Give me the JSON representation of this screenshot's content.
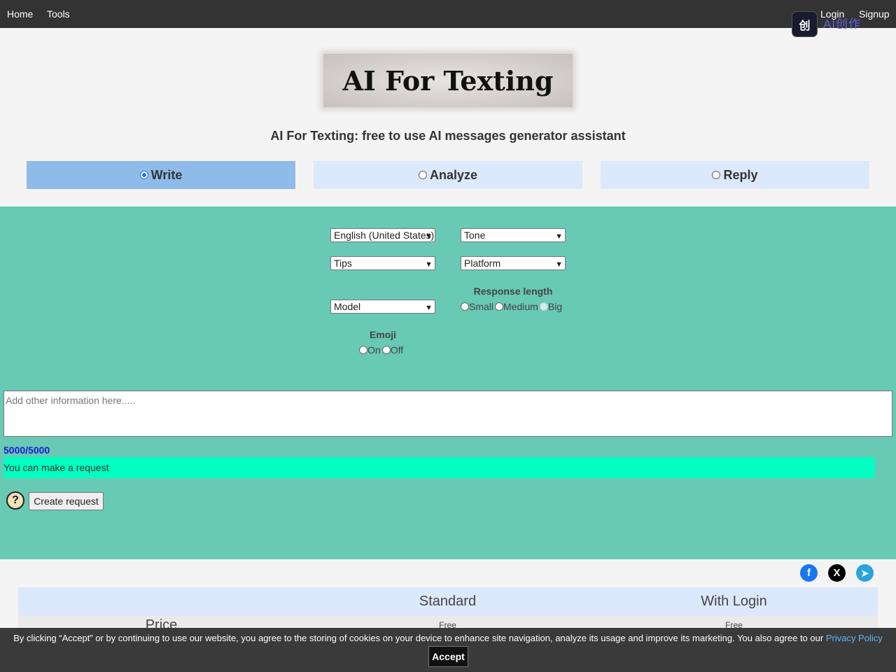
{
  "nav": {
    "home": "Home",
    "tools": "Tools",
    "login": "Login",
    "signup": "Signup",
    "brand_badge": "创",
    "brand_text": "AI创作"
  },
  "logo_text": "AI For Texting",
  "subtitle": "AI For Texting: free to use AI messages generator assistant",
  "modes": {
    "write": "Write",
    "analyze": "Analyze",
    "reply": "Reply",
    "selected": "Write"
  },
  "form": {
    "language": "English (United States)",
    "tone": "Tone",
    "tips": "Tips",
    "platform": "Platform",
    "model": "Model",
    "response_length_label": "Response length",
    "response_options": [
      "Small",
      "Medium",
      "Big"
    ],
    "emoji_label": "Emoji",
    "emoji_options": [
      "On",
      "Off"
    ],
    "textarea_placeholder": "Add other information here.....",
    "counter": "5000/5000",
    "status": "You can make a request",
    "help": "?",
    "create_button": "Create request"
  },
  "social": {
    "facebook": "f",
    "x": "X",
    "telegram": "➤"
  },
  "pricing": {
    "headers": [
      "",
      "Standard",
      "With Login"
    ],
    "row_label": "Price",
    "standard": "Free",
    "with_login": "Free"
  },
  "cookie": {
    "text": "By clicking “Accept” or by continuing to use our website, you agree to the storing of cookies on your device to enhance site navigation, analyze its usage and improve its marketing. You also agree to our",
    "link": "Privacy Policy",
    "accept": "Accept"
  },
  "colors": {
    "nav_bg": "#333333",
    "panel_bg": "#68c9b4",
    "tab_active": "#8fbbe9",
    "tab_inactive": "#dce8fb",
    "status_bg": "#00ffc0",
    "counter": "#1a1ad8"
  }
}
